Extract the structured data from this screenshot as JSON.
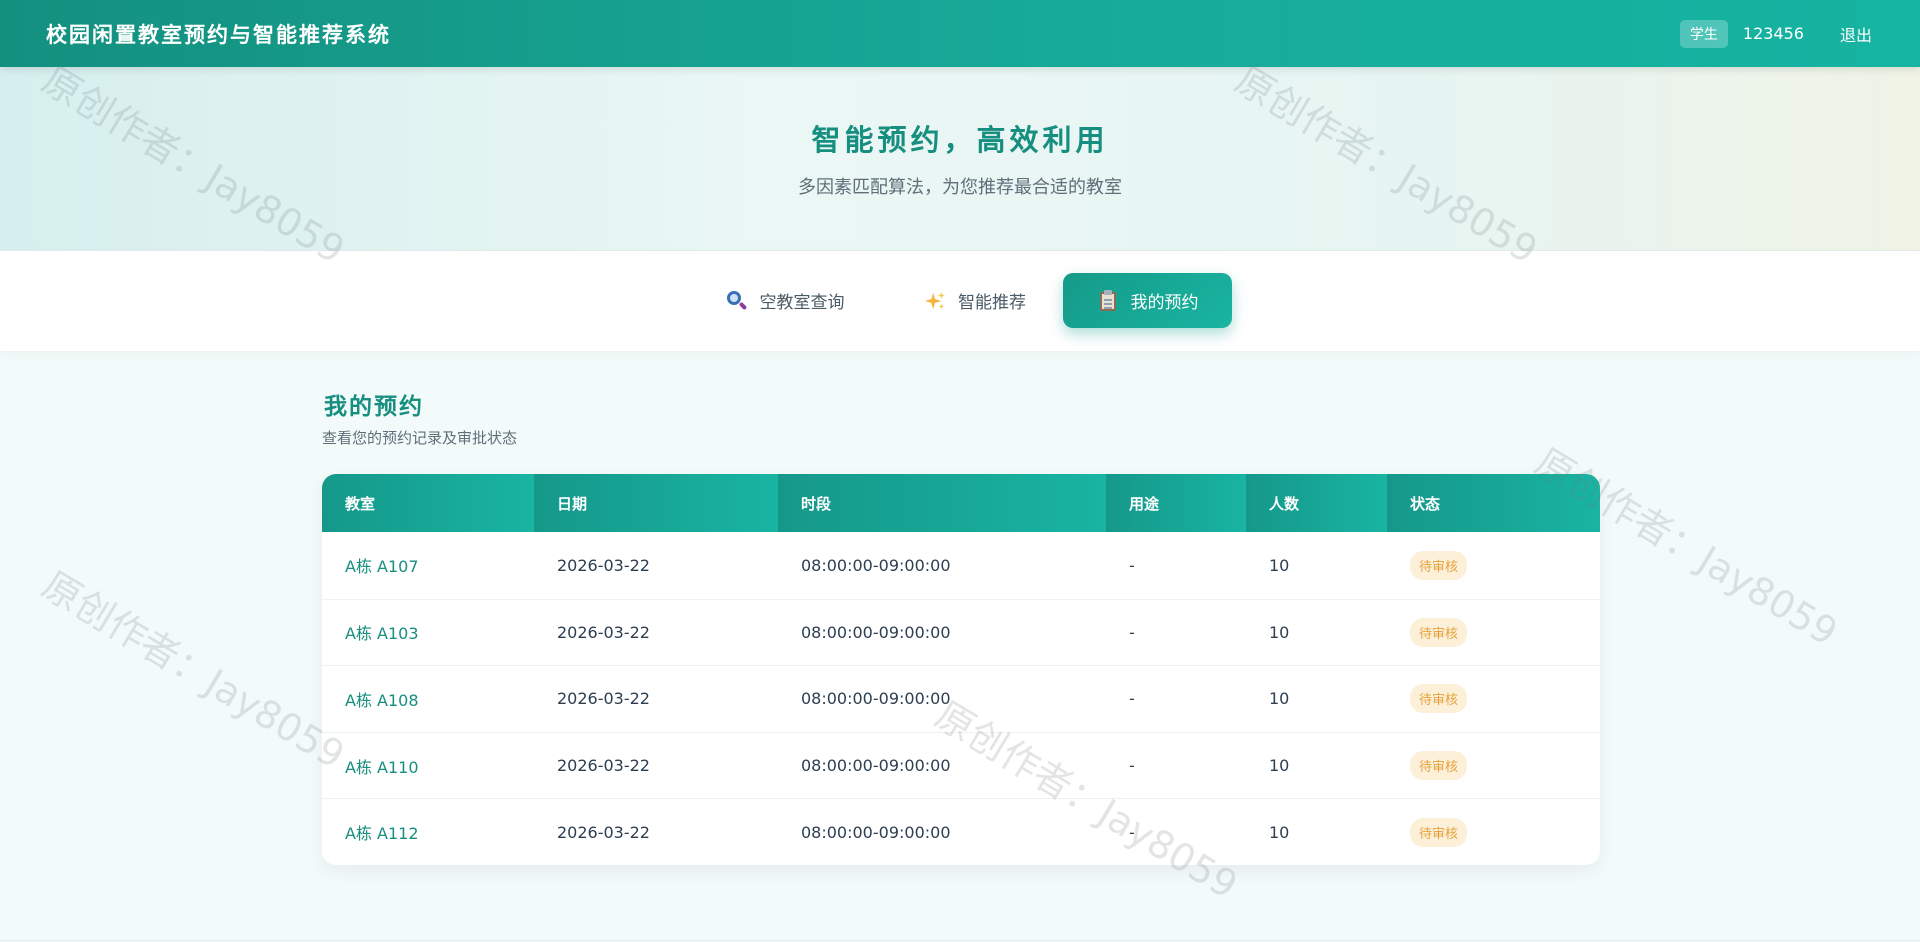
{
  "header": {
    "title": "校园闲置教室预约与智能推荐系统",
    "role_badge": "学生",
    "user_id": "123456",
    "logout_label": "退出"
  },
  "hero": {
    "title": "智能预约，高效利用",
    "subtitle": "多因素匹配算法，为您推荐最合适的教室"
  },
  "tabs": [
    {
      "label": "空教室查询",
      "icon": "search-icon",
      "active": false
    },
    {
      "label": "智能推荐",
      "icon": "sparkles-icon",
      "active": false
    },
    {
      "label": "我的预约",
      "icon": "clipboard-icon",
      "active": true
    }
  ],
  "section": {
    "title": "我的预约",
    "subtitle": "查看您的预约记录及审批状态"
  },
  "table": {
    "columns": [
      "教室",
      "日期",
      "时段",
      "用途",
      "人数",
      "状态"
    ],
    "rows": [
      {
        "room": "A栋 A107",
        "date": "2026-03-22",
        "time": "08:00:00-09:00:00",
        "purpose": "-",
        "count": "10",
        "status": "待审核"
      },
      {
        "room": "A栋 A103",
        "date": "2026-03-22",
        "time": "08:00:00-09:00:00",
        "purpose": "-",
        "count": "10",
        "status": "待审核"
      },
      {
        "room": "A栋 A108",
        "date": "2026-03-22",
        "time": "08:00:00-09:00:00",
        "purpose": "-",
        "count": "10",
        "status": "待审核"
      },
      {
        "room": "A栋 A110",
        "date": "2026-03-22",
        "time": "08:00:00-09:00:00",
        "purpose": "-",
        "count": "10",
        "status": "待审核"
      },
      {
        "room": "A栋 A112",
        "date": "2026-03-22",
        "time": "08:00:00-09:00:00",
        "purpose": "-",
        "count": "10",
        "status": "待审核"
      }
    ]
  },
  "watermark": "原创作者：Jay8059",
  "colors": {
    "primary": "#17a090",
    "status_pending_bg": "#fdf0d8",
    "status_pending_text": "#e6a23c"
  }
}
